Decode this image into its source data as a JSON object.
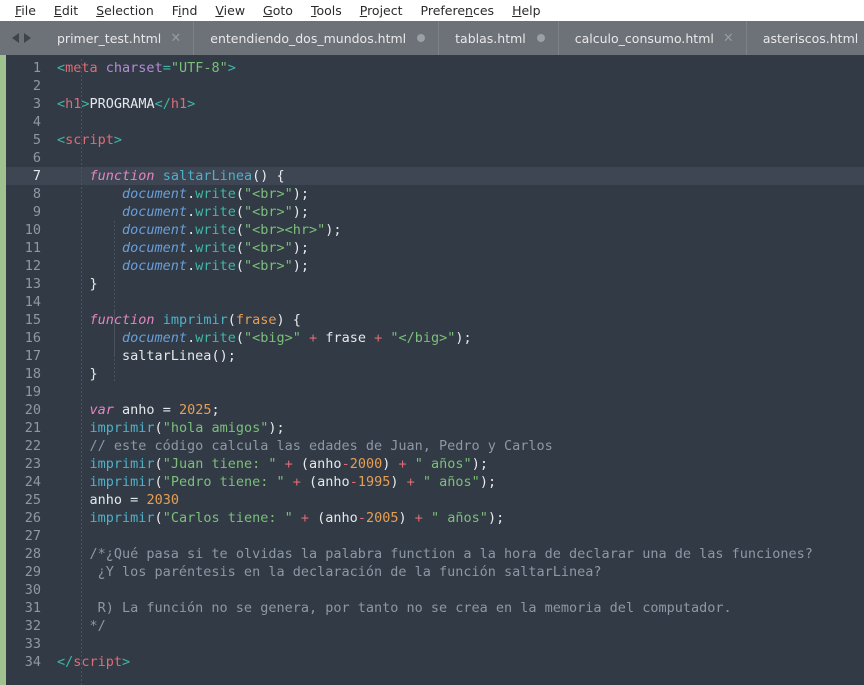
{
  "menu": {
    "items": [
      {
        "label": "File",
        "mnemonic_index": 0
      },
      {
        "label": "Edit",
        "mnemonic_index": 0
      },
      {
        "label": "Selection",
        "mnemonic_index": 0
      },
      {
        "label": "Find",
        "mnemonic_index": 1
      },
      {
        "label": "View",
        "mnemonic_index": 0
      },
      {
        "label": "Goto",
        "mnemonic_index": 0
      },
      {
        "label": "Tools",
        "mnemonic_index": 0
      },
      {
        "label": "Project",
        "mnemonic_index": 0
      },
      {
        "label": "Preferences",
        "mnemonic_index": 7
      },
      {
        "label": "Help",
        "mnemonic_index": 0
      }
    ]
  },
  "tabbar": {
    "nav_prev": "◀",
    "nav_next": "▶",
    "tabs": [
      {
        "label": "primer_test.html",
        "state": "close",
        "close_glyph": "×"
      },
      {
        "label": "entendiendo_dos_mundos.html",
        "state": "dirty"
      },
      {
        "label": "tablas.html",
        "state": "dirty"
      },
      {
        "label": "calculo_consumo.html",
        "state": "close",
        "close_glyph": "×"
      },
      {
        "label": "asteriscos.html",
        "state": "none"
      }
    ]
  },
  "editor": {
    "active_line": 7,
    "total_lines": 34,
    "accent_color": "#a0c28f",
    "background_color": "#323a45",
    "active_line_color": "#3e4653",
    "line_numbers": [
      1,
      2,
      3,
      4,
      5,
      6,
      7,
      8,
      9,
      10,
      11,
      12,
      13,
      14,
      15,
      16,
      17,
      18,
      19,
      20,
      21,
      22,
      23,
      24,
      25,
      26,
      27,
      28,
      29,
      30,
      31,
      32,
      33,
      34
    ],
    "lines": [
      {
        "n": 1,
        "tokens": [
          {
            "t": "<",
            "c": "t-punct"
          },
          {
            "t": "meta",
            "c": "t-tag"
          },
          {
            "t": " ",
            "c": "t-plain"
          },
          {
            "t": "charset",
            "c": "t-attr"
          },
          {
            "t": "=",
            "c": "t-punct"
          },
          {
            "t": "\"UTF-8\"",
            "c": "t-str"
          },
          {
            "t": ">",
            "c": "t-punct"
          }
        ]
      },
      {
        "n": 2,
        "tokens": []
      },
      {
        "n": 3,
        "tokens": [
          {
            "t": "<",
            "c": "t-punct"
          },
          {
            "t": "h1",
            "c": "t-tag"
          },
          {
            "t": ">",
            "c": "t-punct"
          },
          {
            "t": "PROGRAMA",
            "c": "t-plain"
          },
          {
            "t": "</",
            "c": "t-punct"
          },
          {
            "t": "h1",
            "c": "t-tag"
          },
          {
            "t": ">",
            "c": "t-punct"
          }
        ]
      },
      {
        "n": 4,
        "tokens": []
      },
      {
        "n": 5,
        "tokens": [
          {
            "t": "<",
            "c": "t-punct"
          },
          {
            "t": "script",
            "c": "t-tag"
          },
          {
            "t": ">",
            "c": "t-punct"
          }
        ]
      },
      {
        "n": 6,
        "tokens": []
      },
      {
        "n": 7,
        "tokens": [
          {
            "t": "    ",
            "c": "t-plain"
          },
          {
            "t": "function",
            "c": "t-kw"
          },
          {
            "t": " ",
            "c": "t-plain"
          },
          {
            "t": "saltarLinea",
            "c": "t-fn"
          },
          {
            "t": "()",
            "c": "t-paren"
          },
          {
            "t": " ",
            "c": "t-plain"
          },
          {
            "t": "{",
            "c": "t-paren"
          }
        ]
      },
      {
        "n": 8,
        "tokens": [
          {
            "t": "        ",
            "c": "t-plain"
          },
          {
            "t": "document",
            "c": "t-obj"
          },
          {
            "t": ".",
            "c": "t-plain"
          },
          {
            "t": "write",
            "c": "t-prop"
          },
          {
            "t": "(",
            "c": "t-paren"
          },
          {
            "t": "\"<br>\"",
            "c": "t-str"
          },
          {
            "t": ");",
            "c": "t-paren"
          }
        ]
      },
      {
        "n": 9,
        "tokens": [
          {
            "t": "        ",
            "c": "t-plain"
          },
          {
            "t": "document",
            "c": "t-obj"
          },
          {
            "t": ".",
            "c": "t-plain"
          },
          {
            "t": "write",
            "c": "t-prop"
          },
          {
            "t": "(",
            "c": "t-paren"
          },
          {
            "t": "\"<br>\"",
            "c": "t-str"
          },
          {
            "t": ");",
            "c": "t-paren"
          }
        ]
      },
      {
        "n": 10,
        "tokens": [
          {
            "t": "        ",
            "c": "t-plain"
          },
          {
            "t": "document",
            "c": "t-obj"
          },
          {
            "t": ".",
            "c": "t-plain"
          },
          {
            "t": "write",
            "c": "t-prop"
          },
          {
            "t": "(",
            "c": "t-paren"
          },
          {
            "t": "\"<br><hr>\"",
            "c": "t-str"
          },
          {
            "t": ");",
            "c": "t-paren"
          }
        ]
      },
      {
        "n": 11,
        "tokens": [
          {
            "t": "        ",
            "c": "t-plain"
          },
          {
            "t": "document",
            "c": "t-obj"
          },
          {
            "t": ".",
            "c": "t-plain"
          },
          {
            "t": "write",
            "c": "t-prop"
          },
          {
            "t": "(",
            "c": "t-paren"
          },
          {
            "t": "\"<br>\"",
            "c": "t-str"
          },
          {
            "t": ");",
            "c": "t-paren"
          }
        ]
      },
      {
        "n": 12,
        "tokens": [
          {
            "t": "        ",
            "c": "t-plain"
          },
          {
            "t": "document",
            "c": "t-obj"
          },
          {
            "t": ".",
            "c": "t-plain"
          },
          {
            "t": "write",
            "c": "t-prop"
          },
          {
            "t": "(",
            "c": "t-paren"
          },
          {
            "t": "\"<br>\"",
            "c": "t-str"
          },
          {
            "t": ");",
            "c": "t-paren"
          }
        ]
      },
      {
        "n": 13,
        "tokens": [
          {
            "t": "    ",
            "c": "t-plain"
          },
          {
            "t": "}",
            "c": "t-paren"
          }
        ]
      },
      {
        "n": 14,
        "tokens": []
      },
      {
        "n": 15,
        "tokens": [
          {
            "t": "    ",
            "c": "t-plain"
          },
          {
            "t": "function",
            "c": "t-kw"
          },
          {
            "t": " ",
            "c": "t-plain"
          },
          {
            "t": "imprimir",
            "c": "t-fn"
          },
          {
            "t": "(",
            "c": "t-paren"
          },
          {
            "t": "frase",
            "c": "t-param"
          },
          {
            "t": ")",
            "c": "t-paren"
          },
          {
            "t": " ",
            "c": "t-plain"
          },
          {
            "t": "{",
            "c": "t-paren"
          }
        ]
      },
      {
        "n": 16,
        "tokens": [
          {
            "t": "        ",
            "c": "t-plain"
          },
          {
            "t": "document",
            "c": "t-obj"
          },
          {
            "t": ".",
            "c": "t-plain"
          },
          {
            "t": "write",
            "c": "t-prop"
          },
          {
            "t": "(",
            "c": "t-paren"
          },
          {
            "t": "\"<big>\"",
            "c": "t-str"
          },
          {
            "t": " ",
            "c": "t-plain"
          },
          {
            "t": "+",
            "c": "t-op"
          },
          {
            "t": " ",
            "c": "t-plain"
          },
          {
            "t": "frase",
            "c": "t-plain"
          },
          {
            "t": " ",
            "c": "t-plain"
          },
          {
            "t": "+",
            "c": "t-op"
          },
          {
            "t": " ",
            "c": "t-plain"
          },
          {
            "t": "\"</big>\"",
            "c": "t-str"
          },
          {
            "t": ");",
            "c": "t-paren"
          }
        ]
      },
      {
        "n": 17,
        "tokens": [
          {
            "t": "        ",
            "c": "t-plain"
          },
          {
            "t": "saltarLinea",
            "c": "t-plain"
          },
          {
            "t": "();",
            "c": "t-paren"
          }
        ]
      },
      {
        "n": 18,
        "tokens": [
          {
            "t": "    ",
            "c": "t-plain"
          },
          {
            "t": "}",
            "c": "t-paren"
          }
        ]
      },
      {
        "n": 19,
        "tokens": []
      },
      {
        "n": 20,
        "tokens": [
          {
            "t": "    ",
            "c": "t-plain"
          },
          {
            "t": "var",
            "c": "t-kw"
          },
          {
            "t": " ",
            "c": "t-plain"
          },
          {
            "t": "anho",
            "c": "t-plain"
          },
          {
            "t": " ",
            "c": "t-plain"
          },
          {
            "t": "=",
            "c": "t-plain"
          },
          {
            "t": " ",
            "c": "t-plain"
          },
          {
            "t": "2025",
            "c": "t-num"
          },
          {
            "t": ";",
            "c": "t-paren"
          }
        ]
      },
      {
        "n": 21,
        "tokens": [
          {
            "t": "    ",
            "c": "t-plain"
          },
          {
            "t": "imprimir",
            "c": "t-fn"
          },
          {
            "t": "(",
            "c": "t-paren"
          },
          {
            "t": "\"hola amigos\"",
            "c": "t-str"
          },
          {
            "t": ");",
            "c": "t-paren"
          }
        ]
      },
      {
        "n": 22,
        "tokens": [
          {
            "t": "    ",
            "c": "t-plain"
          },
          {
            "t": "// este código calcula las edades de Juan, Pedro y Carlos",
            "c": "t-comment"
          }
        ]
      },
      {
        "n": 23,
        "tokens": [
          {
            "t": "    ",
            "c": "t-plain"
          },
          {
            "t": "imprimir",
            "c": "t-fn"
          },
          {
            "t": "(",
            "c": "t-paren"
          },
          {
            "t": "\"Juan tiene: \"",
            "c": "t-str"
          },
          {
            "t": " ",
            "c": "t-plain"
          },
          {
            "t": "+",
            "c": "t-op"
          },
          {
            "t": " ",
            "c": "t-plain"
          },
          {
            "t": "(",
            "c": "t-paren"
          },
          {
            "t": "anho",
            "c": "t-plain"
          },
          {
            "t": "-",
            "c": "t-op"
          },
          {
            "t": "2000",
            "c": "t-num"
          },
          {
            "t": ")",
            "c": "t-paren"
          },
          {
            "t": " ",
            "c": "t-plain"
          },
          {
            "t": "+",
            "c": "t-op"
          },
          {
            "t": " ",
            "c": "t-plain"
          },
          {
            "t": "\" años\"",
            "c": "t-str"
          },
          {
            "t": ");",
            "c": "t-paren"
          }
        ]
      },
      {
        "n": 24,
        "tokens": [
          {
            "t": "    ",
            "c": "t-plain"
          },
          {
            "t": "imprimir",
            "c": "t-fn"
          },
          {
            "t": "(",
            "c": "t-paren"
          },
          {
            "t": "\"Pedro tiene: \"",
            "c": "t-str"
          },
          {
            "t": " ",
            "c": "t-plain"
          },
          {
            "t": "+",
            "c": "t-op"
          },
          {
            "t": " ",
            "c": "t-plain"
          },
          {
            "t": "(",
            "c": "t-paren"
          },
          {
            "t": "anho",
            "c": "t-plain"
          },
          {
            "t": "-",
            "c": "t-op"
          },
          {
            "t": "1995",
            "c": "t-num"
          },
          {
            "t": ")",
            "c": "t-paren"
          },
          {
            "t": " ",
            "c": "t-plain"
          },
          {
            "t": "+",
            "c": "t-op"
          },
          {
            "t": " ",
            "c": "t-plain"
          },
          {
            "t": "\" años\"",
            "c": "t-str"
          },
          {
            "t": ");",
            "c": "t-paren"
          }
        ]
      },
      {
        "n": 25,
        "tokens": [
          {
            "t": "    ",
            "c": "t-plain"
          },
          {
            "t": "anho",
            "c": "t-plain"
          },
          {
            "t": " ",
            "c": "t-plain"
          },
          {
            "t": "=",
            "c": "t-plain"
          },
          {
            "t": " ",
            "c": "t-plain"
          },
          {
            "t": "2030",
            "c": "t-num"
          }
        ]
      },
      {
        "n": 26,
        "tokens": [
          {
            "t": "    ",
            "c": "t-plain"
          },
          {
            "t": "imprimir",
            "c": "t-fn"
          },
          {
            "t": "(",
            "c": "t-paren"
          },
          {
            "t": "\"Carlos tiene: \"",
            "c": "t-str"
          },
          {
            "t": " ",
            "c": "t-plain"
          },
          {
            "t": "+",
            "c": "t-op"
          },
          {
            "t": " ",
            "c": "t-plain"
          },
          {
            "t": "(",
            "c": "t-paren"
          },
          {
            "t": "anho",
            "c": "t-plain"
          },
          {
            "t": "-",
            "c": "t-op"
          },
          {
            "t": "2005",
            "c": "t-num"
          },
          {
            "t": ")",
            "c": "t-paren"
          },
          {
            "t": " ",
            "c": "t-plain"
          },
          {
            "t": "+",
            "c": "t-op"
          },
          {
            "t": " ",
            "c": "t-plain"
          },
          {
            "t": "\" años\"",
            "c": "t-str"
          },
          {
            "t": ");",
            "c": "t-paren"
          }
        ]
      },
      {
        "n": 27,
        "tokens": []
      },
      {
        "n": 28,
        "tokens": [
          {
            "t": "    ",
            "c": "t-plain"
          },
          {
            "t": "/*¿Qué pasa si te olvidas la palabra function a la hora de declarar una de las funciones?",
            "c": "t-comment"
          }
        ]
      },
      {
        "n": 29,
        "tokens": [
          {
            "t": "     ¿Y los paréntesis en la declaración de la función saltarLinea?",
            "c": "t-comment"
          }
        ]
      },
      {
        "n": 30,
        "tokens": []
      },
      {
        "n": 31,
        "tokens": [
          {
            "t": "     R) La función no se genera, por tanto no se crea en la memoria del computador.",
            "c": "t-comment"
          }
        ]
      },
      {
        "n": 32,
        "tokens": [
          {
            "t": "    ",
            "c": "t-plain"
          },
          {
            "t": "*/",
            "c": "t-comment"
          }
        ]
      },
      {
        "n": 33,
        "tokens": []
      },
      {
        "n": 34,
        "tokens": [
          {
            "t": "</",
            "c": "t-punct"
          },
          {
            "t": "script",
            "c": "t-tag"
          },
          {
            "t": ">",
            "c": "t-punct"
          }
        ]
      }
    ]
  }
}
